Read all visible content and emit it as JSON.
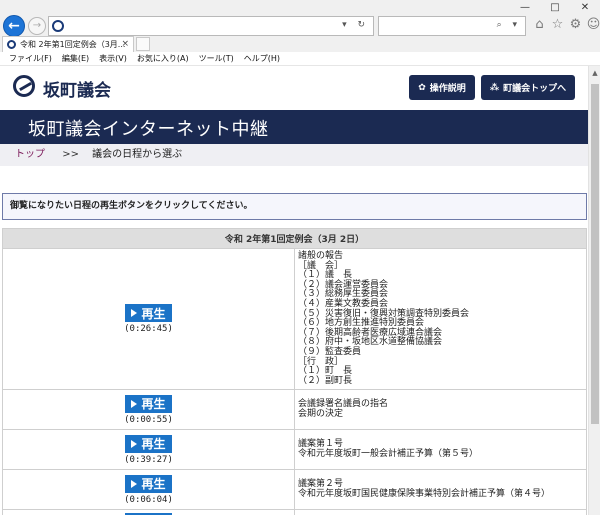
{
  "browser": {
    "win_controls": [
      "—",
      "□",
      "✕"
    ],
    "tab_title": "令和 2年第1回定例会（3月...",
    "tab_close": "×",
    "menu": [
      "ファイル(F)",
      "編集(E)",
      "表示(V)",
      "お気に入り(A)",
      "ツール(T)",
      "ヘルプ(H)"
    ],
    "address_controls": "▾ ↻",
    "search_controls": "⌕ ▾",
    "toolbar_icons": [
      "⌂",
      "☆",
      "⚙",
      "☺"
    ]
  },
  "header": {
    "site_name": "坂町議会",
    "help_button": "操作説明",
    "top_button": "町議会トップへ"
  },
  "banner": {
    "title": "坂町議会インターネット中継"
  },
  "breadcrumb": {
    "home": "トップ",
    "separator": ">>",
    "current": "議会の日程から選ぶ"
  },
  "instruction": "御覧になりたい日程の再生ボタンをクリックしてください。",
  "session": {
    "heading": "令和 2年第1回定例会（3月 2日）",
    "play_label": "再生",
    "rows": [
      {
        "time": "(0:26:45)",
        "text": "諸般の報告\n［議　会］\n（１）議　長\n（２）議会運営委員会\n（３）総務厚生委員会\n（４）産業文教委員会\n（５）災害復旧・復興対策調査特別委員会\n（６）地方創生推進特別委員会\n（７）後期高齢者医療広域連合議会\n（８）府中・坂地区水道整備協議会\n（９）監査委員\n［行　政］\n（１）町　長\n（２）副町長"
      },
      {
        "time": "(0:00:55)",
        "text": "会議録署名議員の指名\n会期の決定"
      },
      {
        "time": "(0:39:27)",
        "text": "議案第１号\n令和元年度坂町一般会計補正予算（第５号）"
      },
      {
        "time": "(0:06:04)",
        "text": "議案第２号\n令和元年度坂町国民健康保険事業特別会計補正予算（第４号）"
      },
      {
        "time": "",
        "text": ""
      }
    ]
  }
}
